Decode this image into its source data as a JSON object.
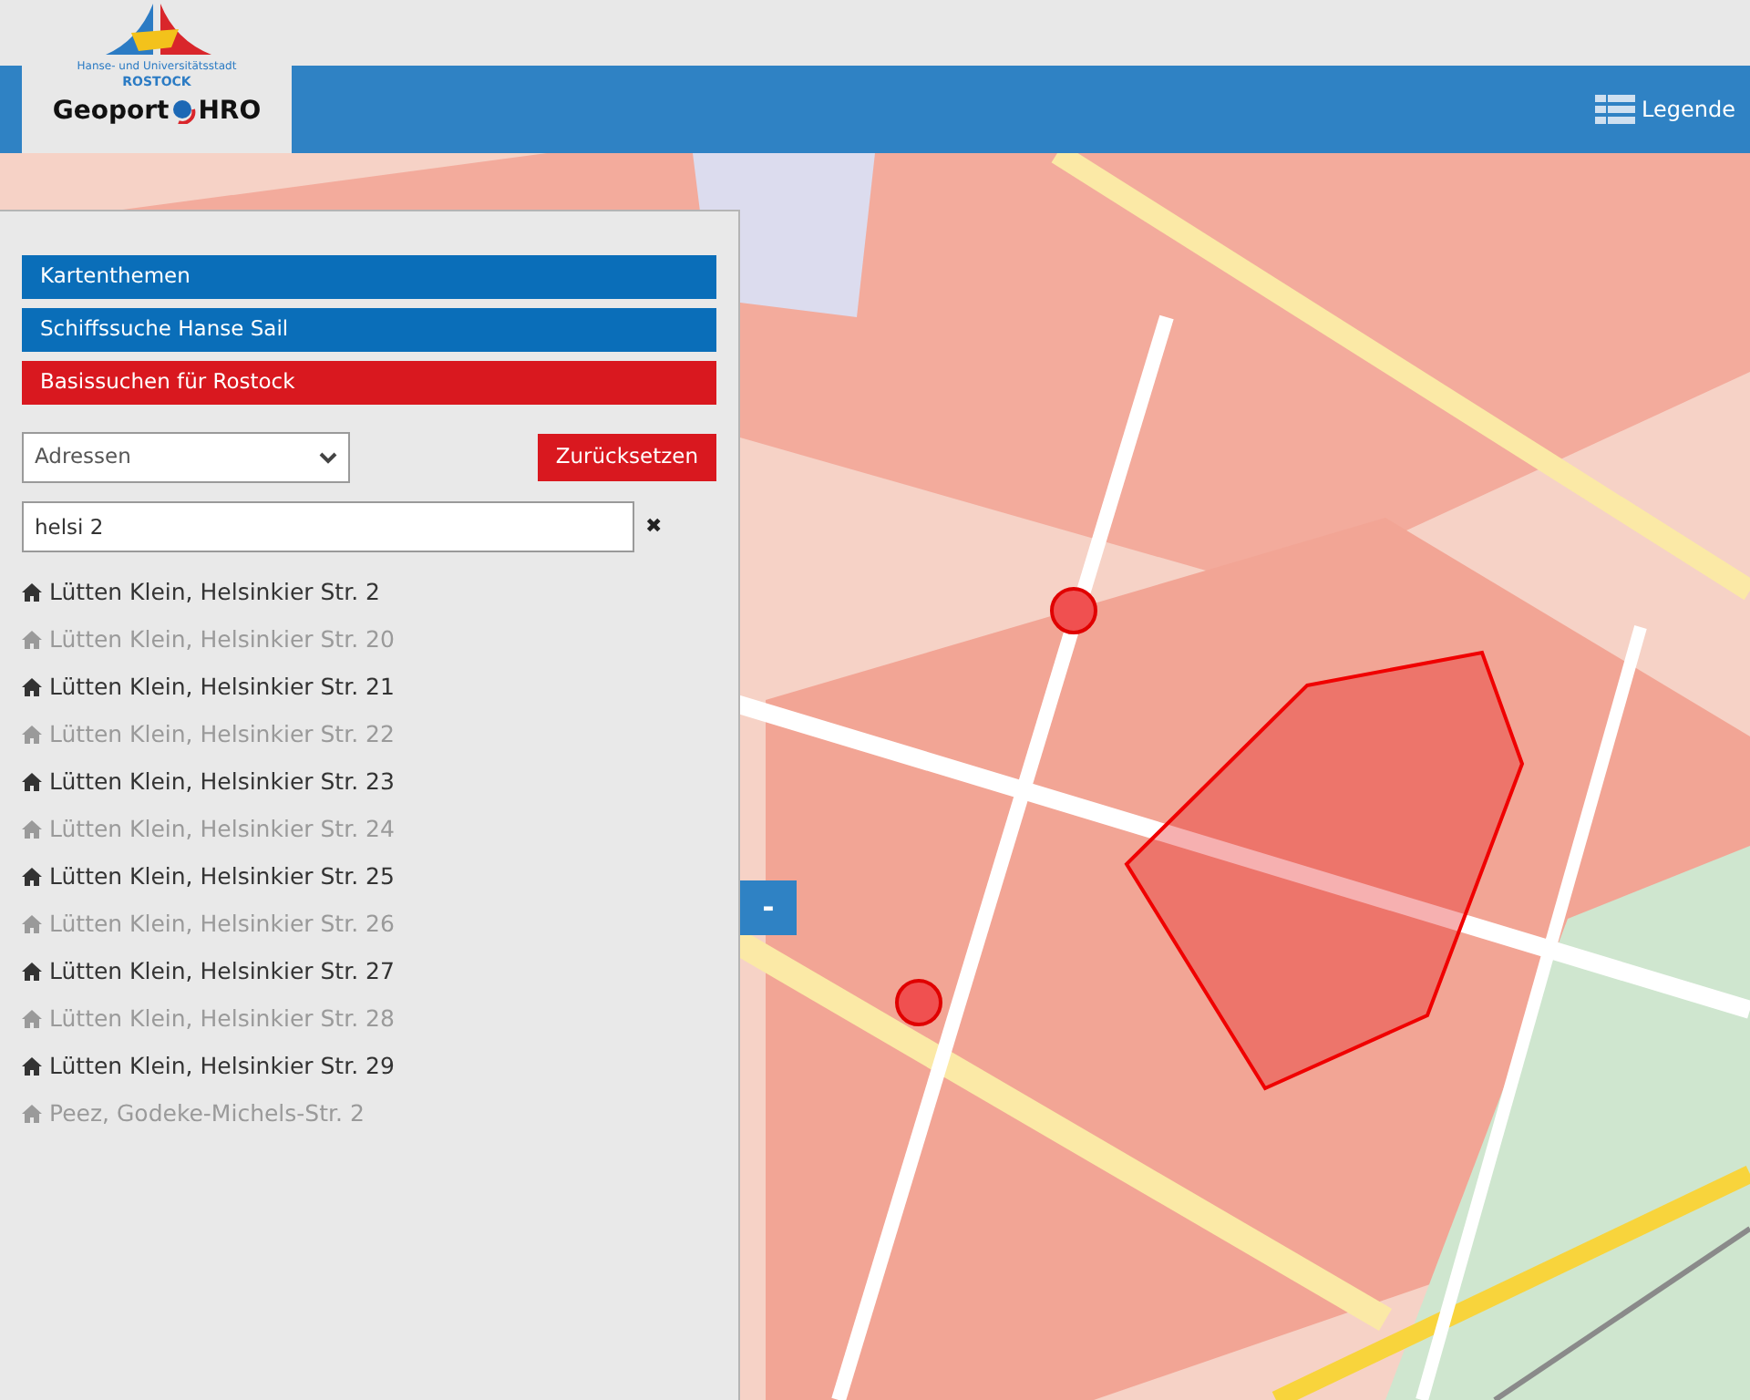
{
  "logo": {
    "city_line": "Hanse- und Universitätsstadt",
    "city": "ROSTOCK",
    "brand_left": "Geoport",
    "brand_right": "HRO"
  },
  "header": {
    "legend_label": "Legende"
  },
  "sidebar": {
    "sections": [
      {
        "label": "Kartenthemen",
        "kind": "blue"
      },
      {
        "label": "Schiffssuche Hanse Sail",
        "kind": "blue"
      },
      {
        "label": "Basissuchen für Rostock",
        "kind": "red"
      }
    ],
    "search_type": {
      "value": "Adressen"
    },
    "reset_label": "Zurücksetzen",
    "search": {
      "value": "helsi 2"
    },
    "clear_icon": "✖",
    "results": [
      {
        "label": "Lütten Klein, Helsinkier Str. 2",
        "dimmed": false
      },
      {
        "label": "Lütten Klein, Helsinkier Str. 20",
        "dimmed": true
      },
      {
        "label": "Lütten Klein, Helsinkier Str. 21",
        "dimmed": false
      },
      {
        "label": "Lütten Klein, Helsinkier Str. 22",
        "dimmed": true
      },
      {
        "label": "Lütten Klein, Helsinkier Str. 23",
        "dimmed": false
      },
      {
        "label": "Lütten Klein, Helsinkier Str. 24",
        "dimmed": true
      },
      {
        "label": "Lütten Klein, Helsinkier Str. 25",
        "dimmed": false
      },
      {
        "label": "Lütten Klein, Helsinkier Str. 26",
        "dimmed": true
      },
      {
        "label": "Lütten Klein, Helsinkier Str. 27",
        "dimmed": false
      },
      {
        "label": "Lütten Klein, Helsinkier Str. 28",
        "dimmed": true
      },
      {
        "label": "Lütten Klein, Helsinkier Str. 29",
        "dimmed": false
      },
      {
        "label": "Peez, Godeke-Michels-Str. 2",
        "dimmed": true
      }
    ]
  },
  "map": {
    "kind": "picture",
    "collapse_button": "-"
  }
}
